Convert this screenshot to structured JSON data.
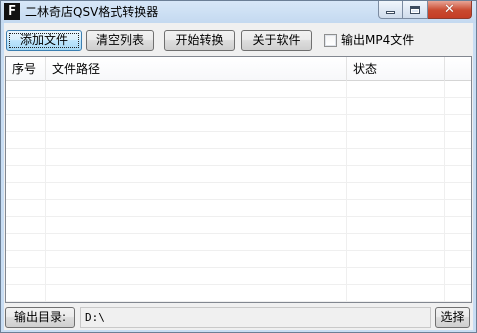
{
  "window": {
    "title": "二林奇店QSV格式转换器",
    "app_icon_letter": "F",
    "controls": {
      "minimize": "minimize-icon",
      "maximize": "maximize-icon",
      "close": "close-icon"
    }
  },
  "toolbar": {
    "add_files": "添加文件",
    "clear_list": "清空列表",
    "start_convert": "开始转换",
    "about": "关于软件",
    "output_mp4": {
      "label": "输出MP4文件",
      "checked": false
    }
  },
  "table": {
    "columns": [
      "序号",
      "文件路径",
      "状态"
    ],
    "rows": []
  },
  "output": {
    "dir_button": "输出目录:",
    "dir_value": "D:\\",
    "choose_button": "选择"
  },
  "colors": {
    "title_bar": "#c8ddf3",
    "focused_button": "#bee6fd",
    "client_bg": "#f0f0f0"
  }
}
